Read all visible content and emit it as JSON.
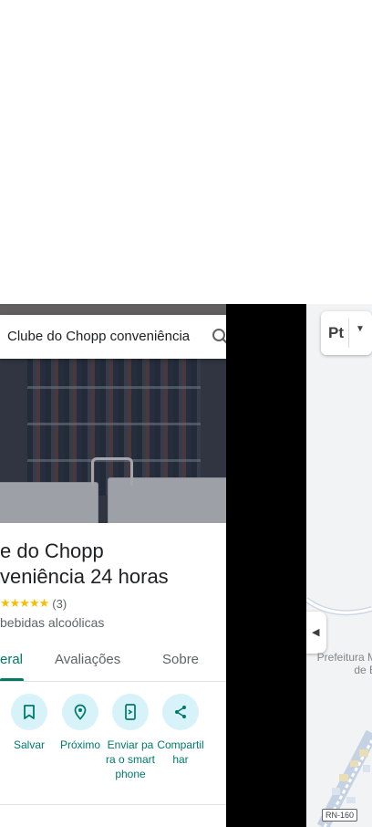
{
  "search": {
    "query": "Clube do Chopp conveniência"
  },
  "place": {
    "title": "e do Chopp\nveniência 24 horas",
    "rating_count": "(3)",
    "stars": "★★★★★",
    "category": "bebidas alcoólicas"
  },
  "tabs": [
    {
      "label": "eral"
    },
    {
      "label": "Avaliações"
    },
    {
      "label": "Sobre"
    }
  ],
  "actions": [
    {
      "label": "Salvar"
    },
    {
      "label": "Próximo"
    },
    {
      "label": "Enviar para o smartphone"
    },
    {
      "label": "Compartilhar"
    }
  ],
  "map": {
    "layers_label": "Pt",
    "place_label": "Prefeitura M\nde B",
    "road_badge": "RN-160"
  },
  "colors": {
    "accent": "#00796b",
    "action_bg": "#d7f3f9",
    "star": "#fbbc04"
  }
}
